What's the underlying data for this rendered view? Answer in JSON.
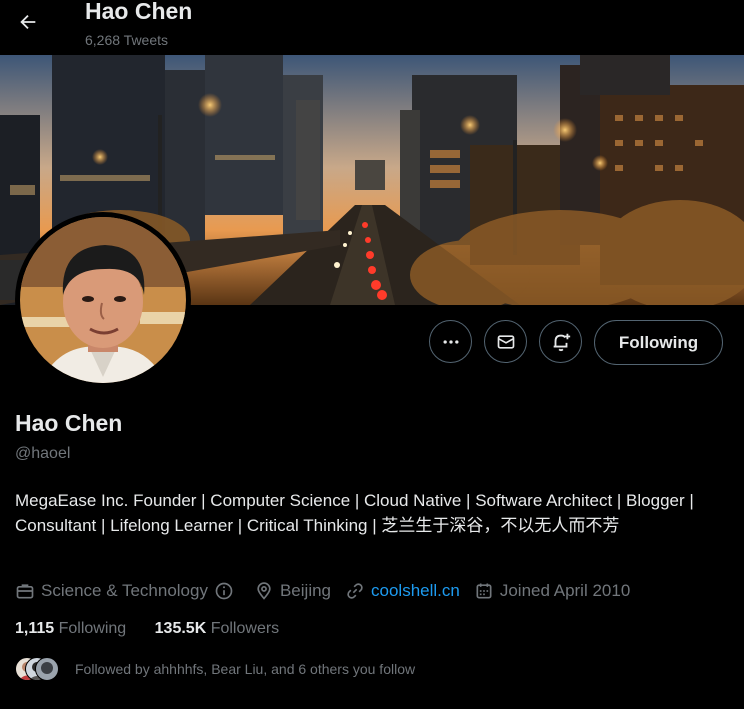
{
  "header": {
    "title": "Hao Chen",
    "tweet_count": "6,268 Tweets"
  },
  "profile": {
    "name": "Hao Chen",
    "handle": "@haoel",
    "bio": "MegaEase Inc. Founder | Computer Science | Cloud Native | Software Architect | Blogger | Consultant | Lifelong Learner | Critical Thinking | 芝兰生于深谷，不以无人而不芳",
    "category": "Science & Technology",
    "location": "Beijing",
    "website": "coolshell.cn",
    "joined": "Joined April 2010",
    "following_count": "1,115",
    "following_label": "Following",
    "followers_count": "135.5K",
    "followers_label": "Followers",
    "followed_by": "Followed by ahhhhfs, Bear Liu, and 6 others you follow"
  },
  "actions": {
    "follow_label": "Following",
    "icons": [
      "more-icon",
      "message-icon",
      "notify-bell-icon"
    ]
  },
  "colors": {
    "background": "#000000",
    "text_primary": "#e7e9ea",
    "text_secondary": "#71767b",
    "link": "#1d9bf0",
    "border": "#536471"
  }
}
